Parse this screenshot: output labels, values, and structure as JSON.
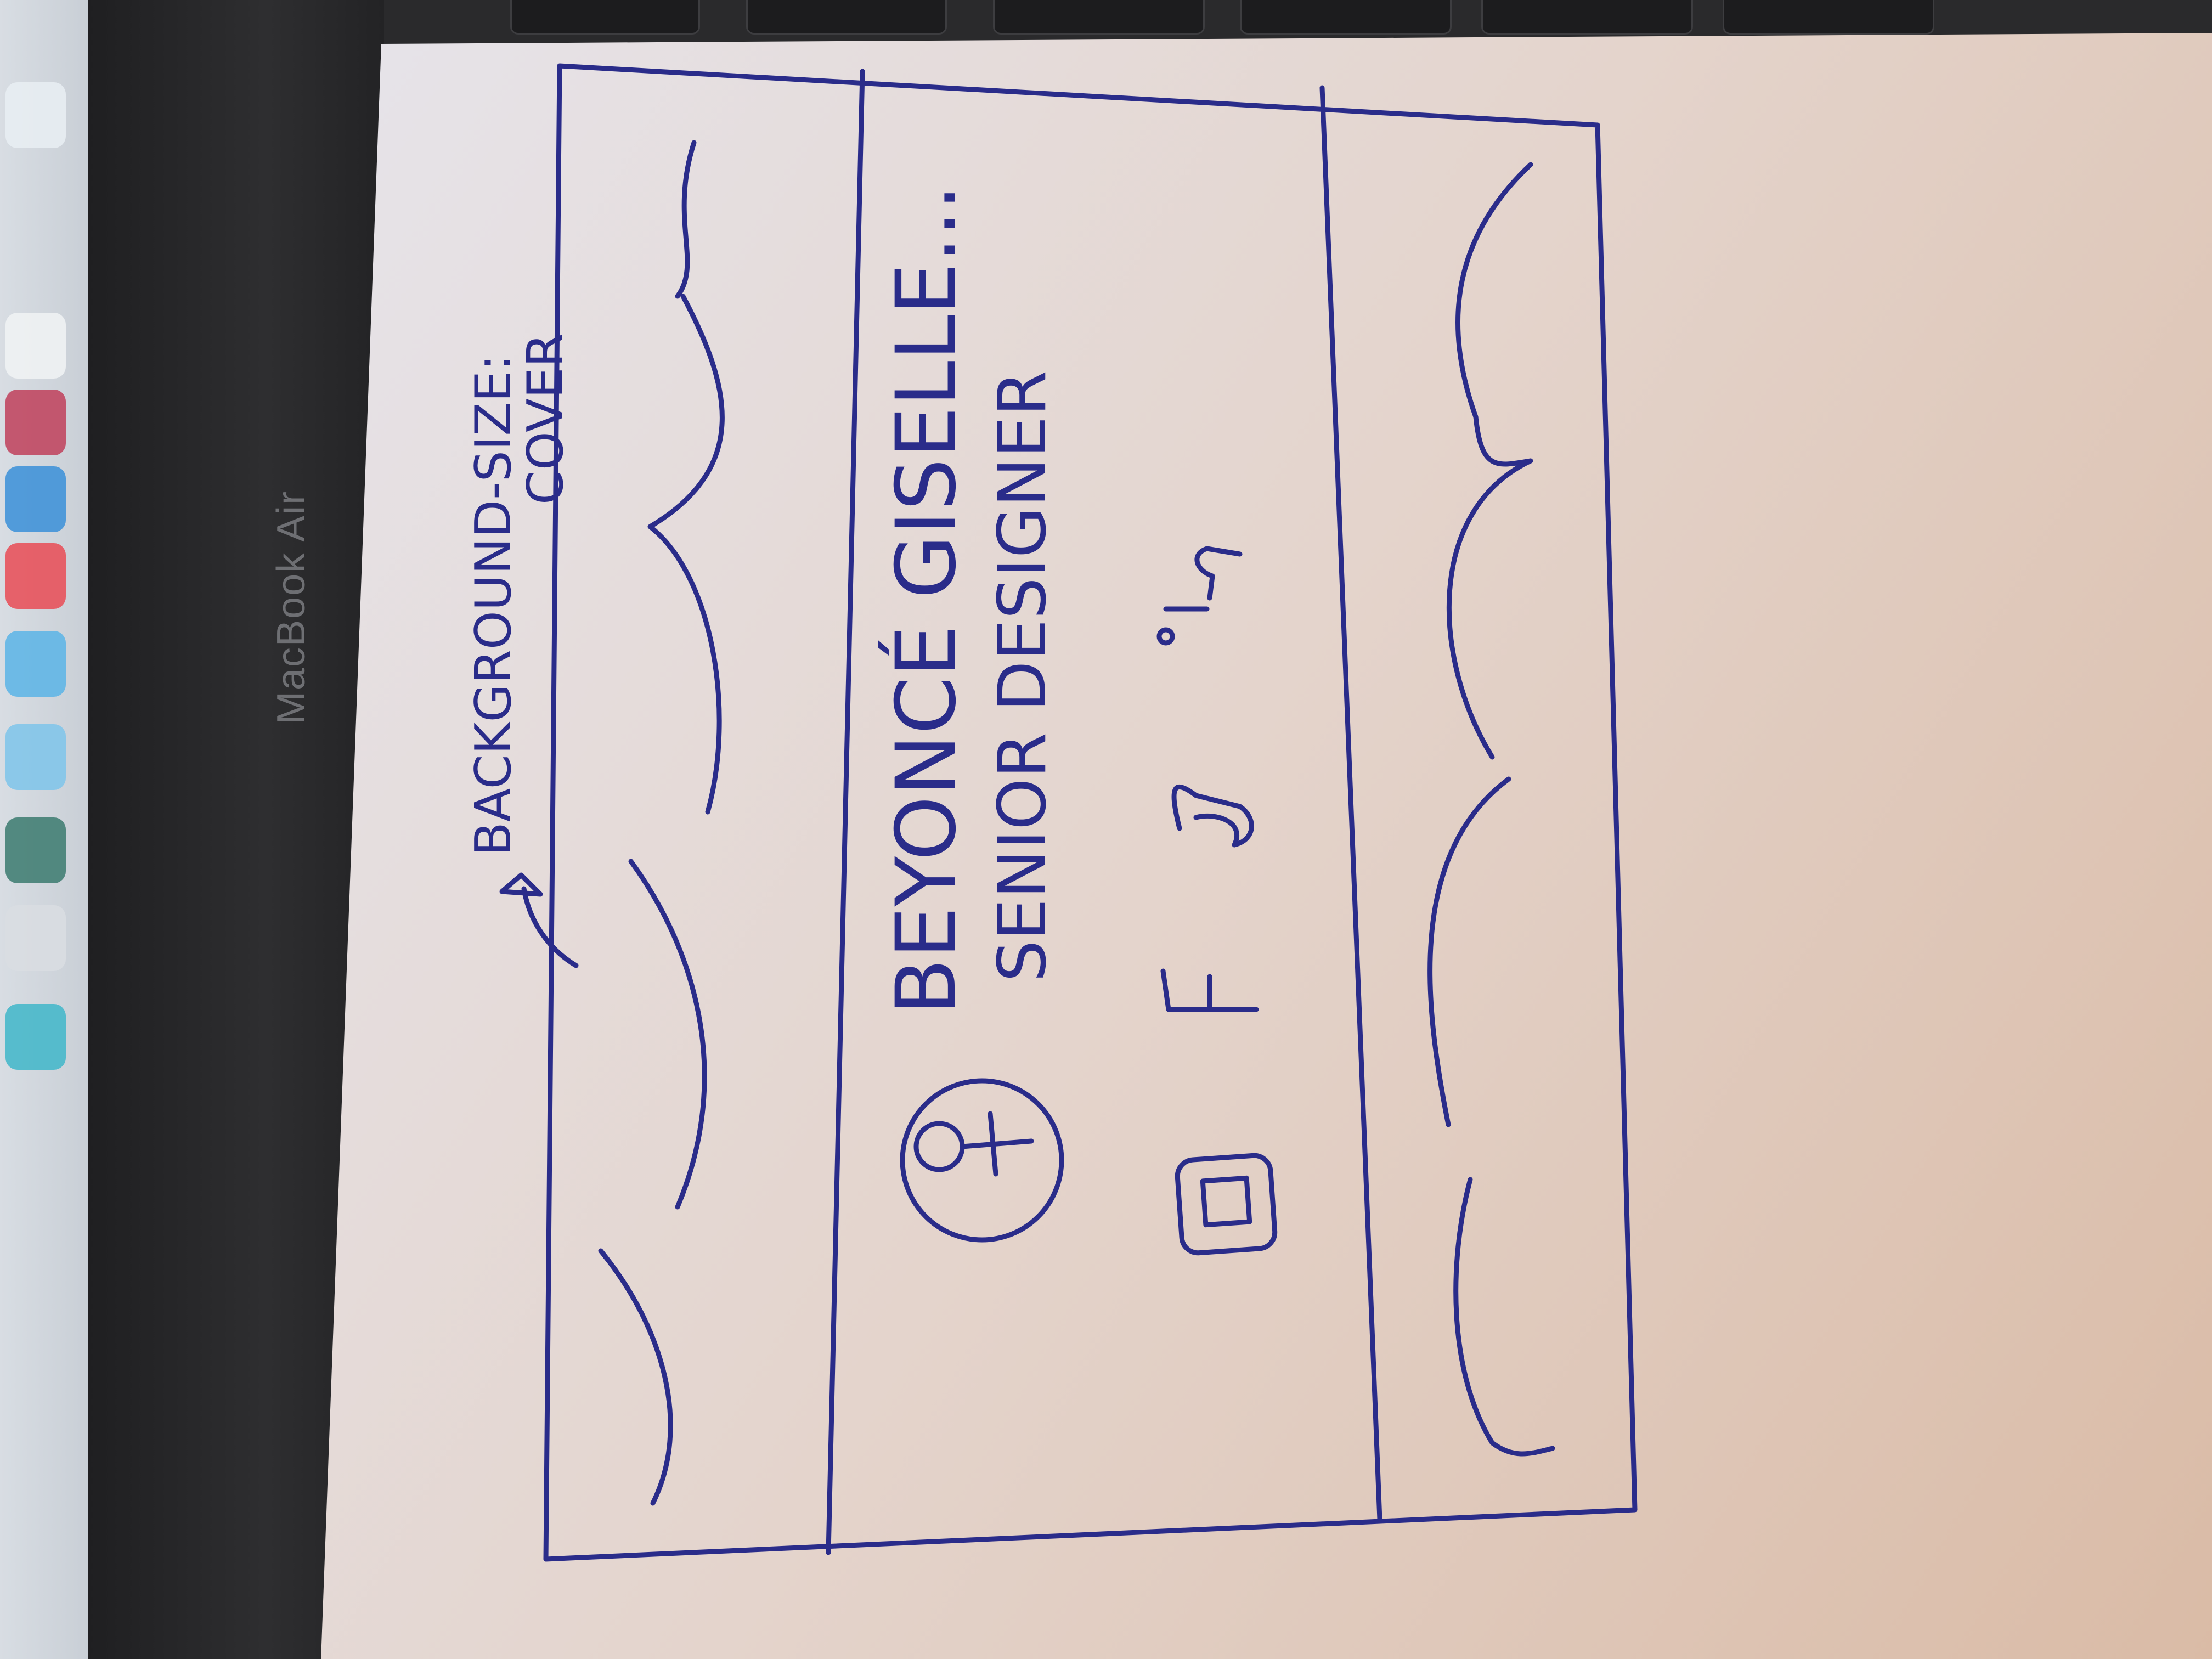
{
  "device": {
    "label": "MacBook Air"
  },
  "annotation": {
    "line1": "BACKGROUND-SIZE:",
    "line2": "COVER"
  },
  "profile": {
    "name": "BEYONCÉ GISELLE...",
    "role": "SENIOR DESIGNER"
  },
  "social_icons": [
    "instagram-icon",
    "facebook-icon",
    "google-icon",
    "linkedin-icon"
  ],
  "colors": {
    "ink": "#2a2c8a",
    "paper": "#e4d4cc"
  }
}
